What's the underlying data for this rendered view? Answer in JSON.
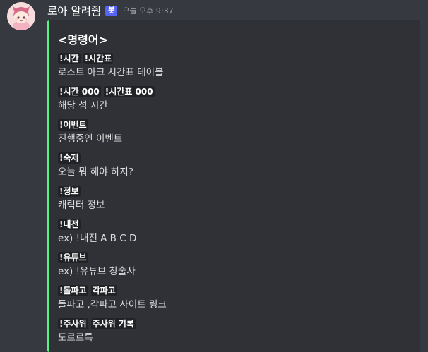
{
  "message": {
    "username": "로아 알려줨",
    "bot_badge": "봇",
    "timestamp": "오늘 오후 9:37",
    "avatar_icon": "anime-girl-avatar"
  },
  "embed": {
    "accent_color": "#57f287",
    "title": "<명령어>",
    "fields": [
      {
        "commands": [
          "!시간",
          "!시간표"
        ],
        "description": "로스트 아크 시간표 테이블"
      },
      {
        "commands": [
          "!시간 000",
          "!시간표 000"
        ],
        "description": "해당 섬 시간"
      },
      {
        "commands": [
          "!이벤트"
        ],
        "description": "진행중인 이벤트"
      },
      {
        "commands": [
          "!숙제"
        ],
        "description": "오늘 뭐 해야 하지?"
      },
      {
        "commands": [
          "!정보"
        ],
        "description": "캐릭터 정보"
      },
      {
        "commands": [
          "!내전"
        ],
        "description": "ex) !내전 A B C D"
      },
      {
        "commands": [
          "!유튜브"
        ],
        "description": "ex) !유튜브 창술사"
      },
      {
        "commands": [
          "!돌파고",
          "각파고"
        ],
        "description": "돌파고 ,각파고 사이트 링크"
      },
      {
        "commands": [
          "!주사위",
          "주사위 기록"
        ],
        "description": "도르르륵"
      }
    ]
  }
}
